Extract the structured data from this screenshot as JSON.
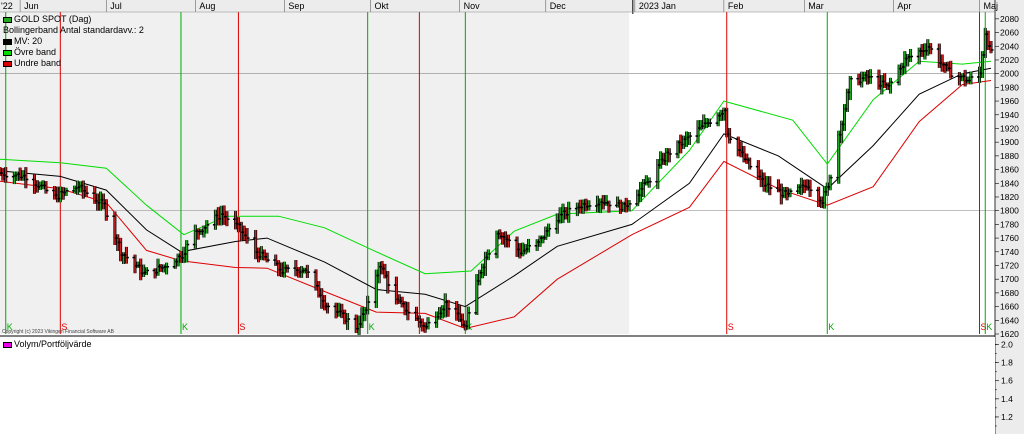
{
  "chart_data": [
    {
      "type": "ohlc",
      "instrument": "GOLD SPOT (Dag)",
      "indicator_label": "Bollingerband  Antal standardavv.: 2",
      "legend": [
        {
          "label": "GOLD SPOT (Dag)",
          "color": "#22aa22"
        },
        {
          "label": "MV: 20",
          "color": "#000000"
        },
        {
          "label": "Övre band",
          "color": "#00dd00"
        },
        {
          "label": "Undre band",
          "color": "#dd0000"
        }
      ],
      "copyright": "Copyright (c) 2023 Vikingen Financial Software AB",
      "ylim": [
        1620,
        2090
      ],
      "y_ticks": [
        1620,
        1640,
        1660,
        1680,
        1700,
        1720,
        1740,
        1760,
        1780,
        1800,
        1820,
        1840,
        1860,
        1880,
        1900,
        1920,
        1940,
        1960,
        1980,
        2000,
        2020,
        2040,
        2060,
        2080
      ],
      "h_lines": [
        1800,
        2000
      ],
      "x_labels": [
        "'22",
        "Jun",
        "Jul",
        "Aug",
        "Sep",
        "Okt",
        "Nov",
        "Dec",
        "2023 Jan",
        "Feb",
        "Mar",
        "Apr",
        "Maj"
      ],
      "date_range": [
        "2022-05-25",
        "2023-05-05"
      ],
      "month_starts": [
        "2022-06-01",
        "2022-07-01",
        "2022-08-01",
        "2022-09-01",
        "2022-10-01",
        "2022-11-01",
        "2022-12-01",
        "2023-01-01",
        "2023-02-01",
        "2023-03-01",
        "2023-04-01",
        "2023-05-01"
      ],
      "shaded_range": [
        "2022-05-25",
        "2022-12-30"
      ],
      "signals": [
        {
          "date": "2022-05-27",
          "type": "K",
          "color": "#00aa00"
        },
        {
          "date": "2022-06-15",
          "type": "S",
          "color": "#dd0000"
        },
        {
          "date": "2022-07-27",
          "type": "K",
          "color": "#00aa00"
        },
        {
          "date": "2022-08-16",
          "type": "S",
          "color": "#dd0000"
        },
        {
          "date": "2022-09-30",
          "type": "K",
          "color": "#00aa00"
        },
        {
          "date": "2022-10-18",
          "type": "S",
          "color": "#dd0000"
        },
        {
          "date": "2022-11-03",
          "type": "K",
          "color": "#00aa00"
        },
        {
          "date": "2023-02-02",
          "type": "S",
          "color": "#dd0000"
        },
        {
          "date": "2023-03-09",
          "type": "K",
          "color": "#00aa00"
        },
        {
          "date": "2023-05-01",
          "type": "S",
          "color": "#dd0000"
        },
        {
          "date": "2023-05-03",
          "type": "K",
          "color": "#00aa00"
        }
      ],
      "close_series": [
        [
          "2022-05-25",
          1855
        ],
        [
          "2022-06-03",
          1850
        ],
        [
          "2022-06-13",
          1820
        ],
        [
          "2022-06-21",
          1835
        ],
        [
          "2022-06-30",
          1808
        ],
        [
          "2022-07-06",
          1740
        ],
        [
          "2022-07-14",
          1708
        ],
        [
          "2022-07-21",
          1718
        ],
        [
          "2022-07-27",
          1735
        ],
        [
          "2022-08-01",
          1768
        ],
        [
          "2022-08-10",
          1795
        ],
        [
          "2022-08-16",
          1775
        ],
        [
          "2022-08-22",
          1740
        ],
        [
          "2022-08-31",
          1712
        ],
        [
          "2022-09-08",
          1715
        ],
        [
          "2022-09-15",
          1665
        ],
        [
          "2022-09-26",
          1630
        ],
        [
          "2022-09-30",
          1662
        ],
        [
          "2022-10-04",
          1722
        ],
        [
          "2022-10-10",
          1668
        ],
        [
          "2022-10-20",
          1630
        ],
        [
          "2022-10-27",
          1665
        ],
        [
          "2022-11-03",
          1630
        ],
        [
          "2022-11-08",
          1712
        ],
        [
          "2022-11-14",
          1770
        ],
        [
          "2022-11-22",
          1740
        ],
        [
          "2022-11-28",
          1752
        ],
        [
          "2022-12-05",
          1790
        ],
        [
          "2022-12-13",
          1808
        ],
        [
          "2022-12-20",
          1815
        ],
        [
          "2022-12-28",
          1805
        ],
        [
          "2023-01-05",
          1840
        ],
        [
          "2023-01-12",
          1882
        ],
        [
          "2023-01-19",
          1905
        ],
        [
          "2023-01-26",
          1928
        ],
        [
          "2023-02-01",
          1948
        ],
        [
          "2023-02-02",
          1915
        ],
        [
          "2023-02-08",
          1875
        ],
        [
          "2023-02-15",
          1838
        ],
        [
          "2023-02-23",
          1822
        ],
        [
          "2023-03-02",
          1838
        ],
        [
          "2023-03-07",
          1815
        ],
        [
          "2023-03-09",
          1832
        ],
        [
          "2023-03-13",
          1912
        ],
        [
          "2023-03-17",
          1988
        ],
        [
          "2023-03-23",
          1995
        ],
        [
          "2023-03-30",
          1980
        ],
        [
          "2023-04-05",
          2020
        ],
        [
          "2023-04-13",
          2040
        ],
        [
          "2023-04-20",
          2003
        ],
        [
          "2023-04-27",
          1990
        ],
        [
          "2023-05-01",
          2000
        ],
        [
          "2023-05-03",
          2060
        ],
        [
          "2023-05-05",
          2030
        ]
      ],
      "mv20": [
        [
          "2022-05-25",
          1858
        ],
        [
          "2022-06-15",
          1850
        ],
        [
          "2022-07-01",
          1830
        ],
        [
          "2022-07-15",
          1772
        ],
        [
          "2022-07-27",
          1740
        ],
        [
          "2022-08-15",
          1755
        ],
        [
          "2022-08-26",
          1760
        ],
        [
          "2022-09-15",
          1725
        ],
        [
          "2022-10-03",
          1685
        ],
        [
          "2022-10-20",
          1678
        ],
        [
          "2022-11-03",
          1660
        ],
        [
          "2022-11-20",
          1705
        ],
        [
          "2022-12-05",
          1748
        ],
        [
          "2022-12-31",
          1780
        ],
        [
          "2023-01-20",
          1840
        ],
        [
          "2023-02-01",
          1912
        ],
        [
          "2023-02-20",
          1880
        ],
        [
          "2023-03-09",
          1832
        ],
        [
          "2023-03-25",
          1895
        ],
        [
          "2023-04-10",
          1970
        ],
        [
          "2023-04-25",
          2000
        ],
        [
          "2023-05-05",
          2008
        ]
      ],
      "upper_band": [
        [
          "2022-05-25",
          1875
        ],
        [
          "2022-06-15",
          1870
        ],
        [
          "2022-07-01",
          1862
        ],
        [
          "2022-07-15",
          1808
        ],
        [
          "2022-07-28",
          1765
        ],
        [
          "2022-08-12",
          1792
        ],
        [
          "2022-08-30",
          1792
        ],
        [
          "2022-09-15",
          1775
        ],
        [
          "2022-10-03",
          1740
        ],
        [
          "2022-10-20",
          1708
        ],
        [
          "2022-11-05",
          1712
        ],
        [
          "2022-11-20",
          1770
        ],
        [
          "2022-12-05",
          1795
        ],
        [
          "2022-12-31",
          1800
        ],
        [
          "2023-01-20",
          1888
        ],
        [
          "2023-02-01",
          1960
        ],
        [
          "2023-02-25",
          1932
        ],
        [
          "2023-03-09",
          1868
        ],
        [
          "2023-03-25",
          1962
        ],
        [
          "2023-04-10",
          2018
        ],
        [
          "2023-04-25",
          2014
        ],
        [
          "2023-05-05",
          2018
        ]
      ],
      "lower_band": [
        [
          "2022-05-25",
          1843
        ],
        [
          "2022-06-15",
          1832
        ],
        [
          "2022-07-01",
          1812
        ],
        [
          "2022-07-15",
          1742
        ],
        [
          "2022-07-27",
          1727
        ],
        [
          "2022-08-15",
          1717
        ],
        [
          "2022-08-26",
          1716
        ],
        [
          "2022-09-15",
          1682
        ],
        [
          "2022-10-03",
          1652
        ],
        [
          "2022-10-20",
          1650
        ],
        [
          "2022-11-03",
          1628
        ],
        [
          "2022-11-20",
          1645
        ],
        [
          "2022-12-05",
          1700
        ],
        [
          "2022-12-31",
          1765
        ],
        [
          "2023-01-20",
          1805
        ],
        [
          "2023-02-01",
          1872
        ],
        [
          "2023-02-20",
          1832
        ],
        [
          "2023-03-09",
          1808
        ],
        [
          "2023-03-25",
          1835
        ],
        [
          "2023-04-10",
          1930
        ],
        [
          "2023-04-25",
          1984
        ],
        [
          "2023-05-05",
          1990
        ]
      ]
    },
    {
      "type": "line",
      "legend": [
        {
          "label": "Volym/Portföljvärde",
          "color": "#ee00ee"
        }
      ],
      "ylim": [
        1.1,
        2.05
      ],
      "y_ticks": [
        "2.0",
        "1.8",
        "1.6",
        "1.4",
        "1.2"
      ]
    }
  ]
}
